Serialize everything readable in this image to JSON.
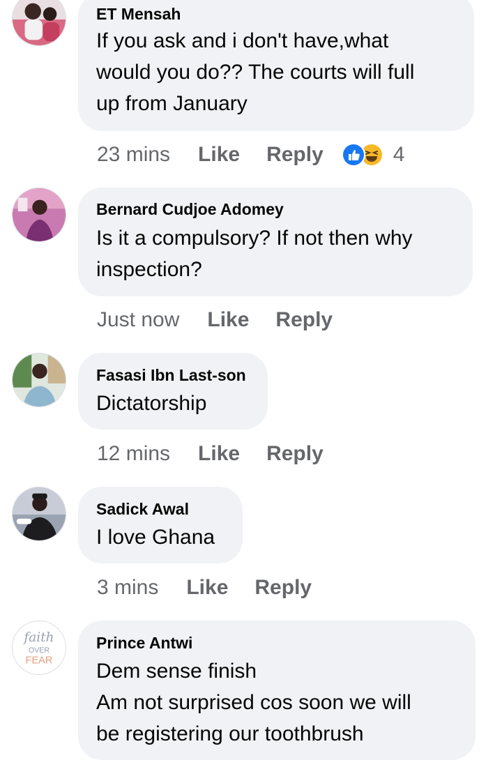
{
  "comments": [
    {
      "author": "ET Mensah",
      "lines": [
        "If you ask and i don't have,what",
        "would you do?? The courts will full",
        "up from January"
      ],
      "time": "23 mins",
      "like_label": "Like",
      "reply_label": "Reply",
      "reactions": [
        "like-icon",
        "haha-icon"
      ],
      "reaction_count": "4"
    },
    {
      "author": "Bernard Cudjoe Adomey",
      "lines": [
        "Is it a compulsory? If not then why",
        "inspection?"
      ],
      "time": "Just now",
      "like_label": "Like",
      "reply_label": "Reply"
    },
    {
      "author": "Fasasi Ibn Last-son",
      "lines": [
        "Dictatorship"
      ],
      "time": "12 mins",
      "like_label": "Like",
      "reply_label": "Reply"
    },
    {
      "author": "Sadick Awal",
      "lines": [
        "I love Ghana"
      ],
      "time": "3 mins",
      "like_label": "Like",
      "reply_label": "Reply"
    },
    {
      "author": "Prince Antwi",
      "lines": [
        "Dem sense finish",
        "Am not surprised cos soon we will",
        "be registering our toothbrush"
      ],
      "avatar_text": [
        "faith",
        "OVER",
        "FEAR"
      ]
    }
  ],
  "colors": {
    "bubble": "#f0f2f5",
    "meta_text": "#65676b",
    "like_blue": "#1877f2",
    "haha_yellow": "#f7b928"
  }
}
